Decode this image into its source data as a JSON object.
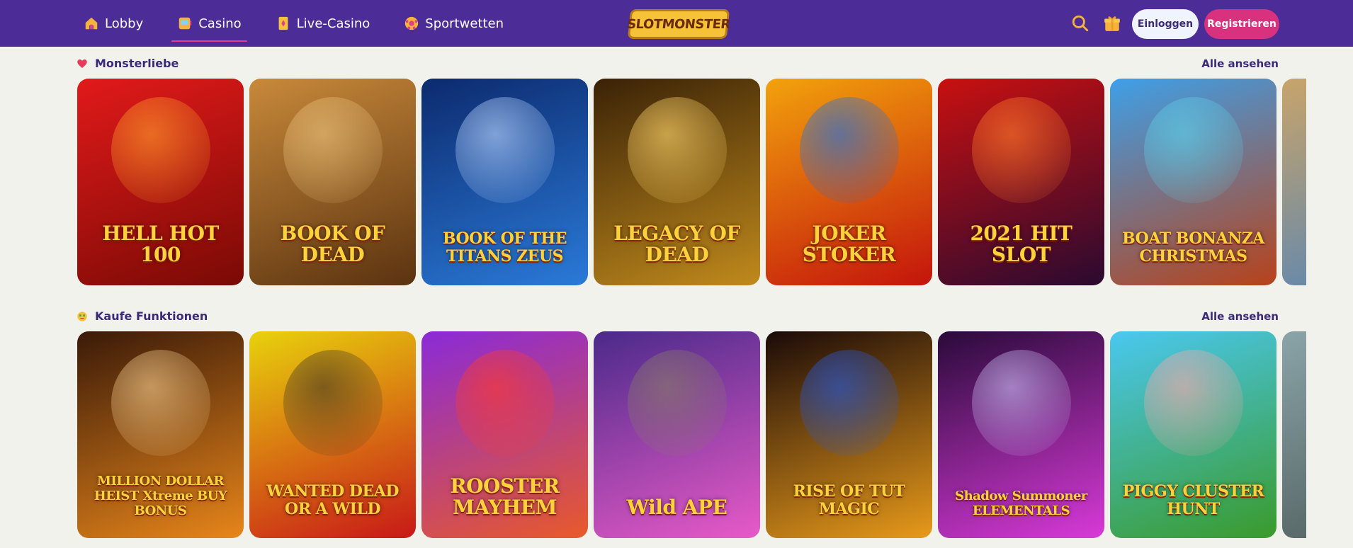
{
  "header": {
    "nav": [
      {
        "label": "Lobby",
        "icon": "house-icon",
        "active": false
      },
      {
        "label": "Casino",
        "icon": "slot-machine-icon",
        "active": true
      },
      {
        "label": "Live-Casino",
        "icon": "playing-card-icon",
        "active": false
      },
      {
        "label": "Sportwetten",
        "icon": "soccer-ball-icon",
        "active": false
      }
    ],
    "logo_text": "SLOTMONSTER",
    "search_icon": "search-icon",
    "gift_icon": "gift-icon",
    "login_label": "Einloggen",
    "register_label": "Registrieren"
  },
  "sections": [
    {
      "title": "Monsterliebe",
      "view_all": "Alle ansehen",
      "games": [
        {
          "name": "HELL HOT 100",
          "bg": "linear-gradient(160deg,#e11a1a,#7a0a05)",
          "deco": "#ff9a2a"
        },
        {
          "name": "BOOK OF DEAD",
          "bg": "linear-gradient(160deg,#c8893a,#5b3310)",
          "deco": "#e8c07a"
        },
        {
          "name": "BOOK OF THE TITANS ZEUS",
          "bg": "linear-gradient(160deg,#0c2a6e,#2a7ad8)",
          "deco": "#b8d4ff"
        },
        {
          "name": "LEGACY OF DEAD",
          "bg": "linear-gradient(160deg,#3a2206,#c08a1c)",
          "deco": "#ffd56a"
        },
        {
          "name": "JOKER STOKER",
          "bg": "linear-gradient(160deg,#f2a20c,#c4140c)",
          "deco": "#1f6ee0"
        },
        {
          "name": "2021 HIT SLOT",
          "bg": "linear-gradient(160deg,#c81010,#2a0a30)",
          "deco": "#ff7a2a"
        },
        {
          "name": "BOAT BONANZA CHRISTMAS",
          "bg": "linear-gradient(160deg,#3ea0e8,#b8421a)",
          "deco": "#5fd0e8"
        }
      ]
    },
    {
      "title": "Kaufe Funktionen",
      "view_all": "Alle ansehen",
      "games": [
        {
          "name": "MILLION DOLLAR HEIST Xtreme BUY BONUS",
          "bg": "linear-gradient(160deg,#3a1a08,#e8861a)",
          "deco": "#f2c98a"
        },
        {
          "name": "WANTED DEAD OR A WILD",
          "bg": "linear-gradient(160deg,#e8d20c,#c81818)",
          "deco": "#4a3a22"
        },
        {
          "name": "ROOSTER MAYHEM",
          "bg": "linear-gradient(160deg,#8a2ad8,#e85a2a)",
          "deco": "#ff3a2a"
        },
        {
          "name": "Wild APE",
          "bg": "linear-gradient(160deg,#4a2a8a,#e85ac8)",
          "deco": "#8a7a6a"
        },
        {
          "name": "RISE OF TUT MAGIC",
          "bg": "linear-gradient(160deg,#1a0a08,#e89a1a)",
          "deco": "#2a5ad8"
        },
        {
          "name": "Shadow Summoner ELEMENTALS",
          "bg": "linear-gradient(160deg,#2a0a3a,#d83ad8)",
          "deco": "#c8b8f0"
        },
        {
          "name": "PIGGY CLUSTER HUNT",
          "bg": "linear-gradient(160deg,#4ac8f0,#3a9a2a)",
          "deco": "#f4a8a8"
        }
      ]
    }
  ]
}
